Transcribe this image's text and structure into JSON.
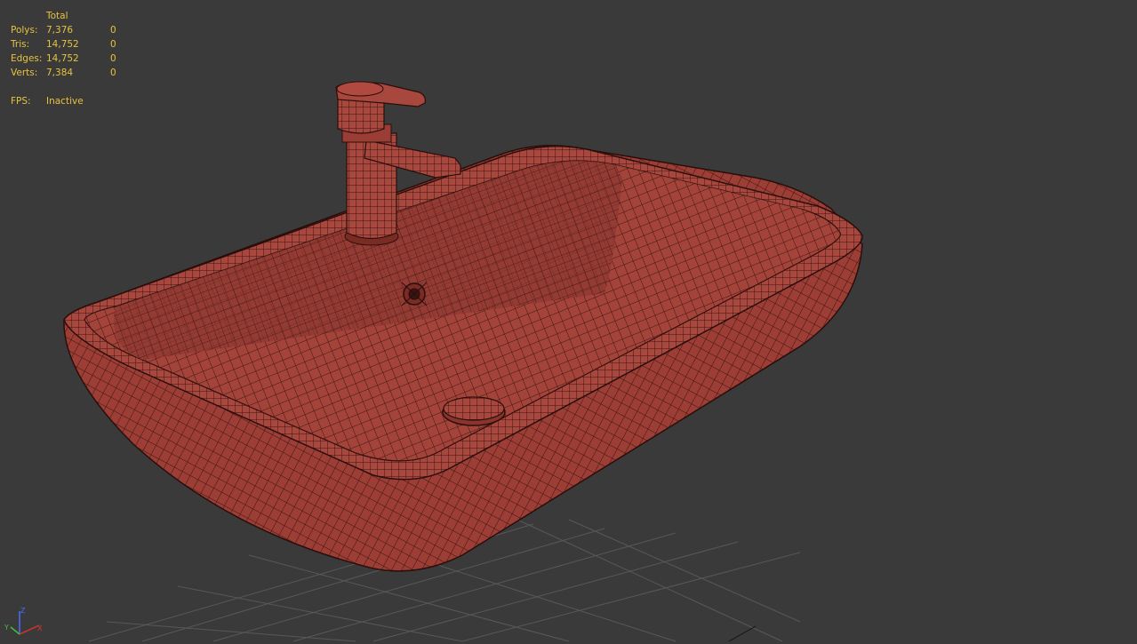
{
  "stats": {
    "header": "Total",
    "rows": [
      {
        "label": "Polys:",
        "total": "7,376",
        "selected": "0"
      },
      {
        "label": "Tris:",
        "total": "14,752",
        "selected": "0"
      },
      {
        "label": "Edges:",
        "total": "14,752",
        "selected": "0"
      },
      {
        "label": "Verts:",
        "total": "7,384",
        "selected": "0"
      }
    ],
    "fps_label": "FPS:",
    "fps_value": "Inactive"
  },
  "gizmo": {
    "x_label": "X",
    "y_label": "Y",
    "z_label": "Z"
  },
  "colors": {
    "background": "#3a3a3a",
    "stats_text": "#e8c33a",
    "mesh_fill": "#a8453c",
    "mesh_wire": "#3a1512",
    "grid": "#5a5a5a"
  }
}
